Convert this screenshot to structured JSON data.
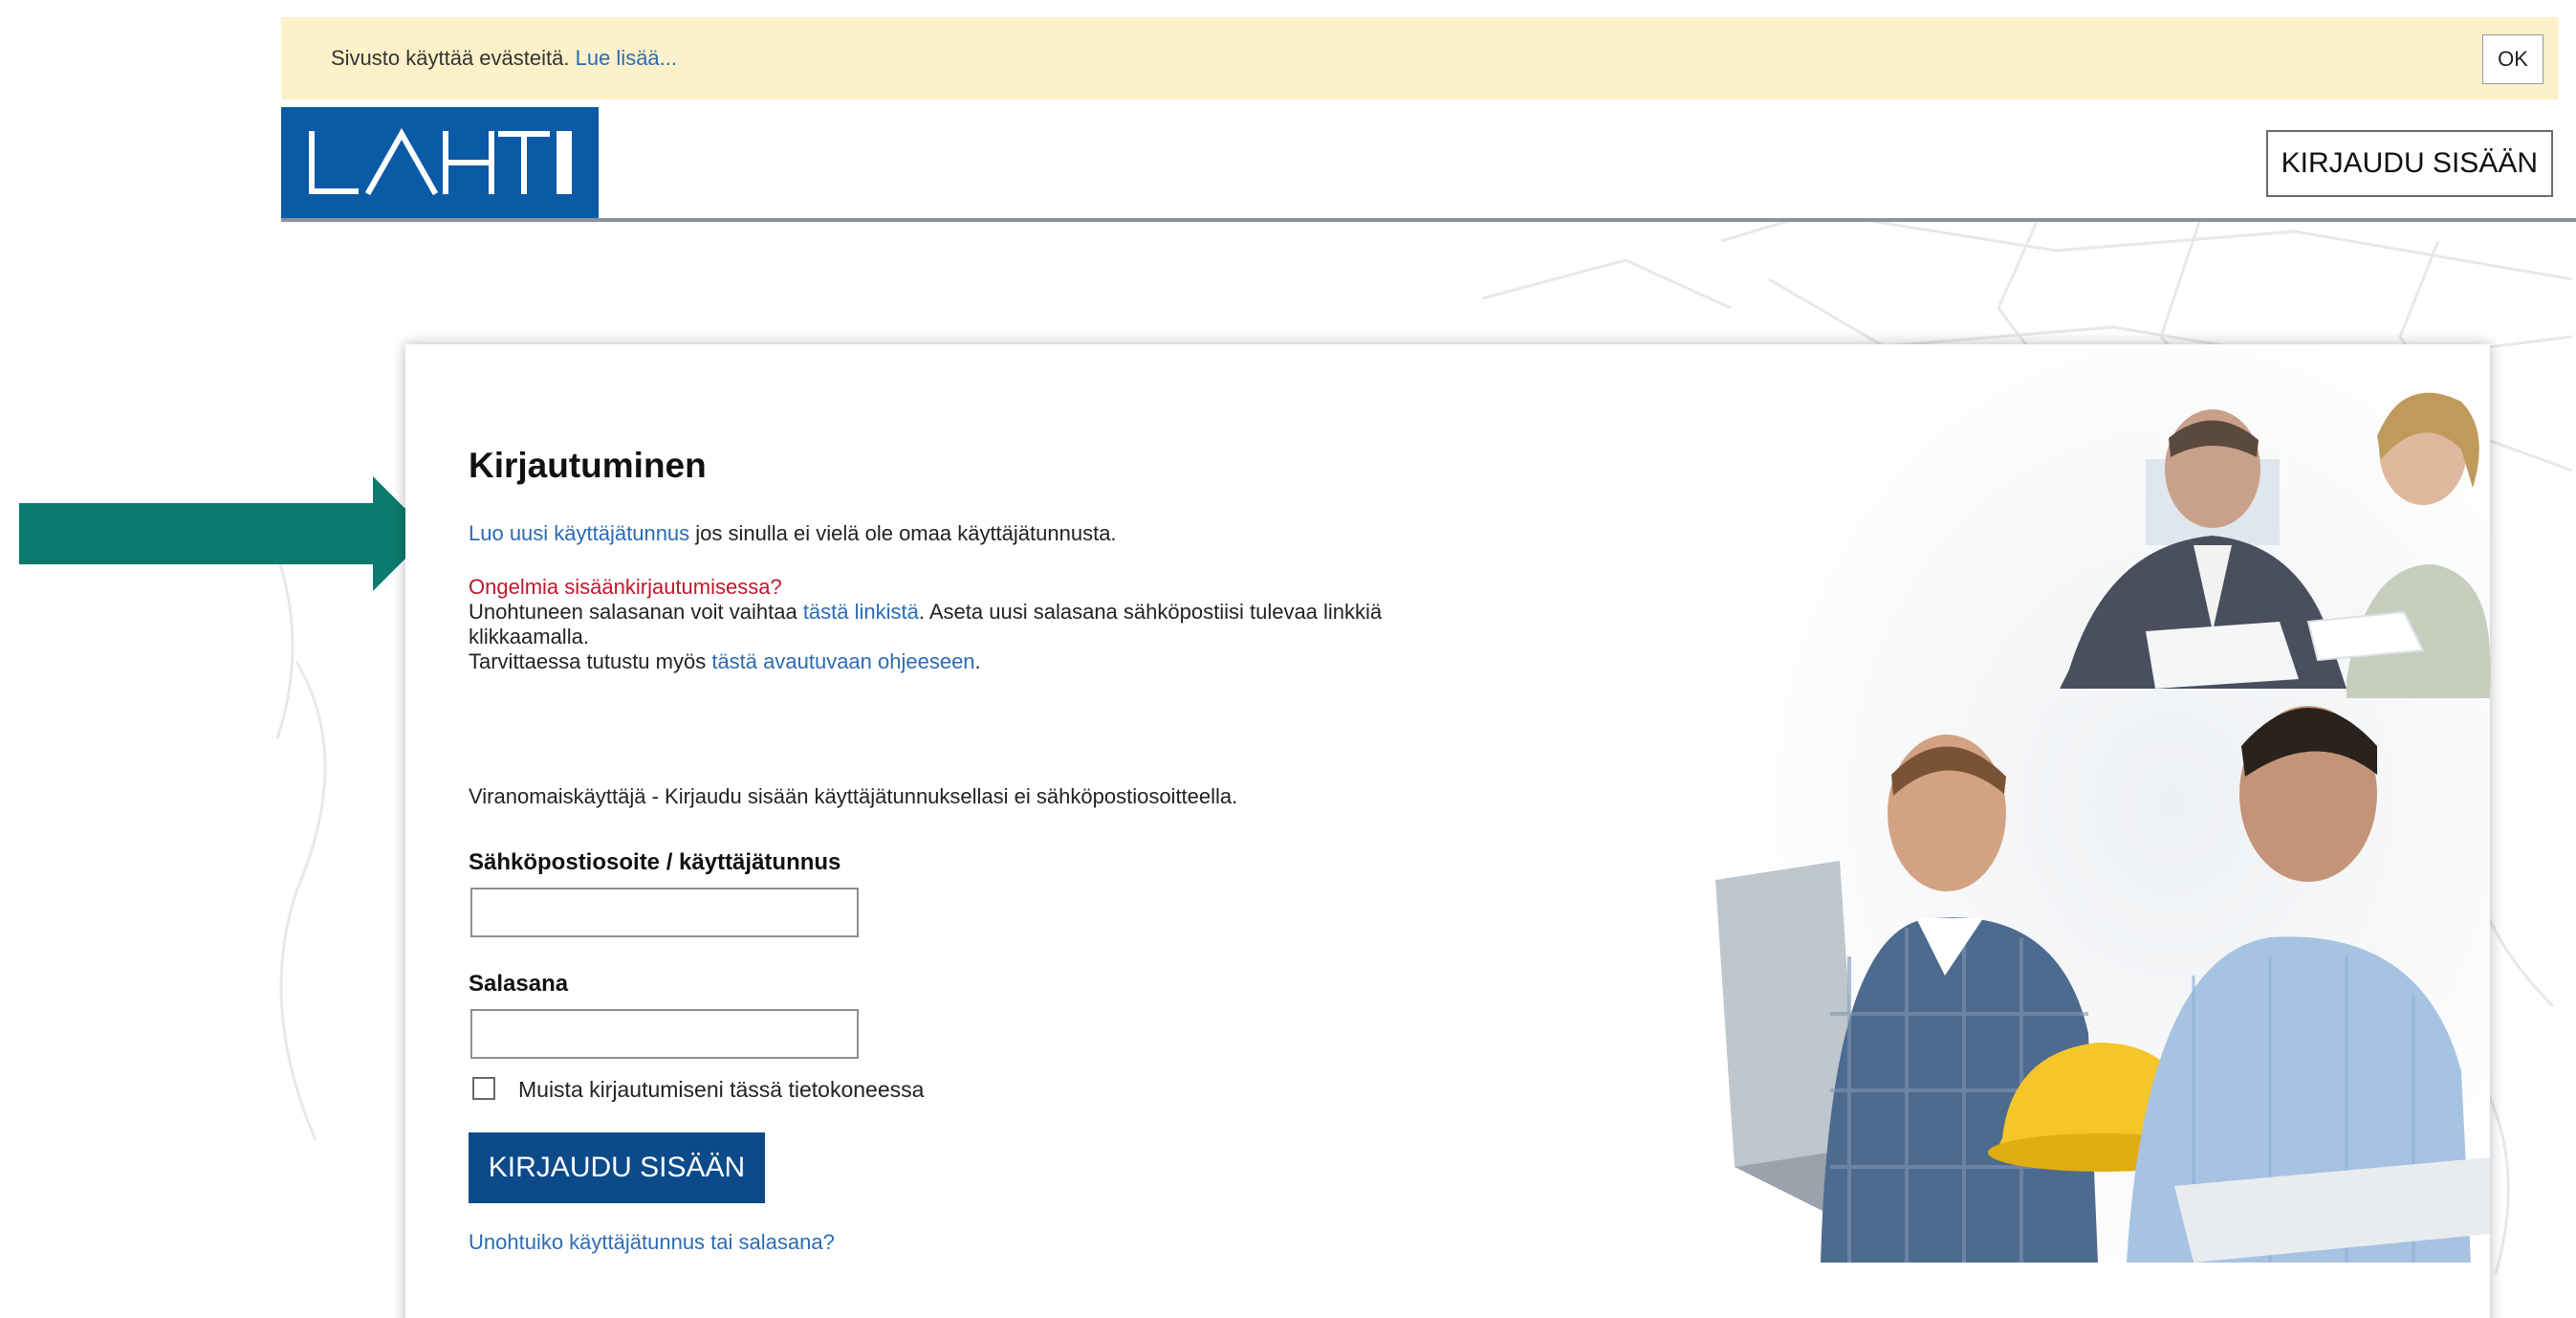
{
  "cookie_bar": {
    "text": "Sivusto käyttää evästeitä.",
    "link": "Lue lisää...",
    "ok_label": "OK"
  },
  "header": {
    "logo_text": "LAHTI",
    "login_button": "KIRJAUDU SISÄÄN"
  },
  "login": {
    "title": "Kirjautuminen",
    "create_account_link": "Luo uusi käyttäjätunnus",
    "create_account_suffix": " jos sinulla ei vielä ole omaa käyttäjätunnusta.",
    "problems_heading": "Ongelmia sisäänkirjautumisessa?",
    "reset_prefix": "Unohtuneen salasanan voit vaihtaa ",
    "reset_link": "tästä linkistä",
    "reset_suffix": ". Aseta uusi salasana sähköpostiisi tulevaa linkkiä",
    "reset_line2": "klikkaamalla.",
    "help_prefix": "Tarvittaessa tutustu myös ",
    "help_link": "tästä avautuvaan ohjeeseen",
    "help_suffix": ".",
    "authority_note": "Viranomaiskäyttäjä - Kirjaudu sisään käyttäjätunnuksellasi ei sähköpostiosoitteella.",
    "username_label": "Sähköpostiosoite / käyttäjätunnus",
    "username_value": "",
    "password_label": "Salasana",
    "password_value": "",
    "remember_label": "Muista kirjautumiseni tässä tietokoneessa",
    "remember_checked": false,
    "submit_label": "KIRJAUDU SISÄÄN",
    "forgot_link": "Unohtuiko käyttäjätunnus tai salasana?"
  },
  "colors": {
    "brand_blue": "#0b5aa6",
    "button_blue": "#0d4a89",
    "link_blue": "#2a6bb5",
    "error_red": "#c0172b",
    "cookie_bg": "#fdf1c9",
    "arrow_teal": "#0c7a6d"
  }
}
